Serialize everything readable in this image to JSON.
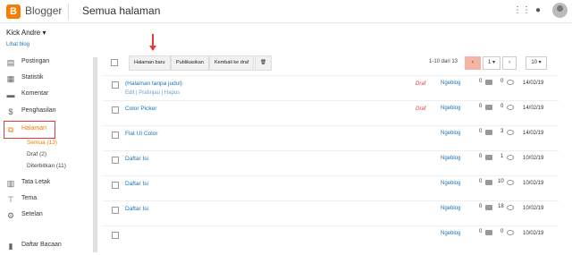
{
  "topbar": {
    "logo": "B",
    "brand": "Blogger",
    "page_title": "Semua halaman"
  },
  "sidebar": {
    "user": "Kick Andre",
    "view_blog": "Lihat blog",
    "items": [
      {
        "label": "Postingan",
        "icon": "▤"
      },
      {
        "label": "Statistik",
        "icon": "▦"
      },
      {
        "label": "Komentar",
        "icon": "▬"
      },
      {
        "label": "Penghasilan",
        "icon": "$"
      },
      {
        "label": "Halaman",
        "icon": "⧉"
      },
      {
        "label": "Tata Letak",
        "icon": "▥"
      },
      {
        "label": "Tema",
        "icon": "⊤"
      },
      {
        "label": "Setelan",
        "icon": "⚙"
      },
      {
        "label": "Daftar Bacaan",
        "icon": "▮"
      }
    ],
    "sub": [
      "Semua (13)",
      "Draf (2)",
      "Diterbitkan (11)"
    ]
  },
  "toolbar": {
    "new_page": "Halaman baru",
    "publish": "Publikasikan",
    "revert": "Kembali ke draf",
    "delete_icon": "🗑",
    "range": "1-10 dari 13",
    "page": "1",
    "per_page": "10"
  },
  "rows": [
    {
      "title": "(Halaman tanpa judul)",
      "actions": "Edit | Pratinjau | Hapus",
      "draft": "Draf",
      "blog": "Ngeblog",
      "comments": "0",
      "views": "0",
      "date": "14/02/19"
    },
    {
      "title": "Color Picker",
      "actions": "",
      "draft": "Draf",
      "blog": "Ngeblog",
      "comments": "0",
      "views": "0",
      "date": "14/02/19"
    },
    {
      "title": "Flat UI Color",
      "actions": "",
      "draft": "",
      "blog": "Ngeblog",
      "comments": "0",
      "views": "3",
      "date": "14/02/19"
    },
    {
      "title": "Daftar Isi",
      "actions": "",
      "draft": "",
      "blog": "Ngeblog",
      "comments": "0",
      "views": "1",
      "date": "10/02/19"
    },
    {
      "title": "Daftar Isi",
      "actions": "",
      "draft": "",
      "blog": "Ngeblog",
      "comments": "0",
      "views": "10",
      "date": "10/02/19"
    },
    {
      "title": "Daftar Isi",
      "actions": "",
      "draft": "",
      "blog": "Ngeblog",
      "comments": "0",
      "views": "18",
      "date": "10/02/19"
    },
    {
      "title": "",
      "actions": "",
      "draft": "",
      "blog": "Ngeblog",
      "comments": "0",
      "views": "0",
      "date": "10/02/19"
    }
  ]
}
